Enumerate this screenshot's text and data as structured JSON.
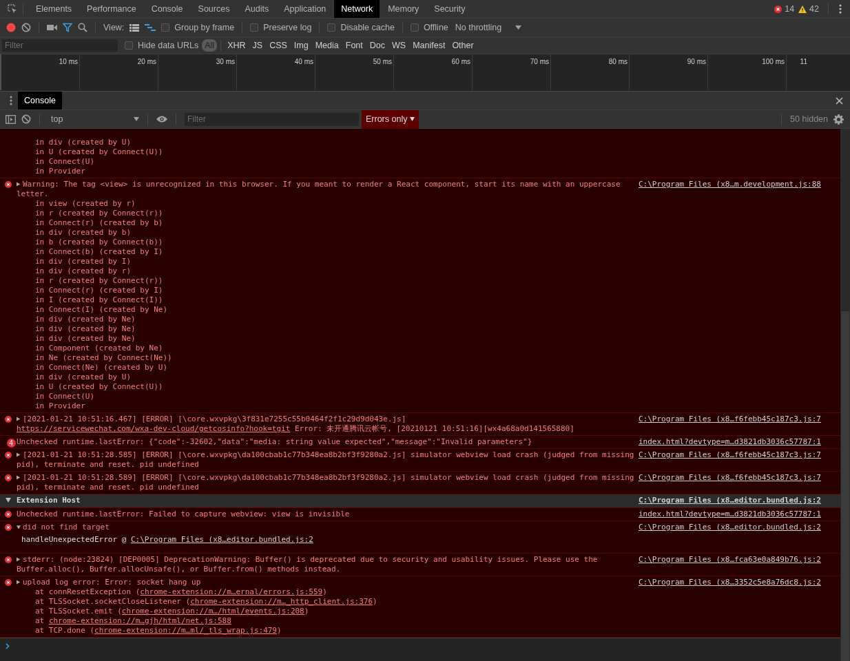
{
  "tabs": [
    {
      "label": "Elements",
      "selected": false
    },
    {
      "label": "Performance",
      "selected": false
    },
    {
      "label": "Console",
      "selected": false
    },
    {
      "label": "Sources",
      "selected": false
    },
    {
      "label": "Audits",
      "selected": false
    },
    {
      "label": "Application",
      "selected": false
    },
    {
      "label": "Network",
      "selected": true
    },
    {
      "label": "Memory",
      "selected": false
    },
    {
      "label": "Security",
      "selected": false
    }
  ],
  "counts": {
    "errors": "14",
    "warnings": "42"
  },
  "network_toolbar": {
    "recording": true,
    "filter_active": true,
    "view_label": "View:",
    "large_rows": false,
    "overview": true,
    "checkboxes": [
      {
        "label": "Group by frame",
        "checked": false
      },
      {
        "label": "Preserve log",
        "checked": false
      },
      {
        "label": "Disable cache",
        "checked": false
      },
      {
        "label": "Offline",
        "checked": false
      }
    ],
    "throttling": "No throttling"
  },
  "filter_bar": {
    "placeholder": "Filter",
    "hide_data_urls": {
      "label": "Hide data URLs",
      "checked": false
    },
    "types": [
      {
        "label": "All",
        "selected": true
      },
      {
        "label": "XHR",
        "selected": false
      },
      {
        "label": "JS",
        "selected": false
      },
      {
        "label": "CSS",
        "selected": false
      },
      {
        "label": "Img",
        "selected": false
      },
      {
        "label": "Media",
        "selected": false
      },
      {
        "label": "Font",
        "selected": false
      },
      {
        "label": "Doc",
        "selected": false
      },
      {
        "label": "WS",
        "selected": false
      },
      {
        "label": "Manifest",
        "selected": false
      },
      {
        "label": "Other",
        "selected": false
      }
    ]
  },
  "timeline": {
    "ticks": [
      "10 ms",
      "20 ms",
      "30 ms",
      "40 ms",
      "50 ms",
      "60 ms",
      "70 ms",
      "80 ms",
      "90 ms",
      "100 ms",
      "11"
    ]
  },
  "drawer": {
    "tabs": [
      {
        "label": "Console",
        "selected": true
      }
    ]
  },
  "console": {
    "context": "top",
    "filter_placeholder": "Filter",
    "level_filter": "Errors only",
    "hidden": "50 hidden",
    "messages": [
      {
        "kind": "continued",
        "stack": [
          {
            "kind": "frame",
            "text": "in div (created by U)"
          },
          {
            "kind": "frame",
            "text": "in U (created by Connect(U))"
          },
          {
            "kind": "frame",
            "text": "in Connect(U)"
          },
          {
            "kind": "frame",
            "text": "in Provider"
          }
        ]
      },
      {
        "kind": "error",
        "expanded": false,
        "parts": [
          {
            "kind": "text",
            "text": "Warning: The tag <view> is unrecognized in this browser. If you meant to render a React component, start its name with an uppercase letter."
          }
        ],
        "source": "C:\\Program Files (x8…m.development.js:88",
        "stack": [
          {
            "kind": "frame",
            "text": "in view (created by r)"
          },
          {
            "kind": "frame",
            "text": "in r (created by Connect(r))"
          },
          {
            "kind": "frame",
            "text": "in Connect(r) (created by b)"
          },
          {
            "kind": "frame",
            "text": "in div (created by b)"
          },
          {
            "kind": "frame",
            "text": "in b (created by Connect(b))"
          },
          {
            "kind": "frame",
            "text": "in Connect(b) (created by I)"
          },
          {
            "kind": "frame",
            "text": "in div (created by I)"
          },
          {
            "kind": "frame",
            "text": "in div (created by r)"
          },
          {
            "kind": "frame",
            "text": "in r (created by Connect(r))"
          },
          {
            "kind": "frame",
            "text": "in Connect(r) (created by I)"
          },
          {
            "kind": "frame",
            "text": "in I (created by Connect(I))"
          },
          {
            "kind": "frame",
            "text": "in Connect(I) (created by Ne)"
          },
          {
            "kind": "frame",
            "text": "in div (created by Ne)"
          },
          {
            "kind": "frame",
            "text": "in div (created by Ne)"
          },
          {
            "kind": "frame",
            "text": "in div (created by Ne)"
          },
          {
            "kind": "frame",
            "text": "in Component (created by Ne)"
          },
          {
            "kind": "frame",
            "text": "in Ne (created by Connect(Ne))"
          },
          {
            "kind": "frame",
            "text": "in Connect(Ne) (created by U)"
          },
          {
            "kind": "frame",
            "text": "in div (created by U)"
          },
          {
            "kind": "frame",
            "text": "in U (created by Connect(U))"
          },
          {
            "kind": "frame",
            "text": "in Connect(U)"
          },
          {
            "kind": "frame",
            "text": "in Provider"
          }
        ]
      },
      {
        "kind": "error",
        "expanded": false,
        "parts": [
          {
            "kind": "text",
            "text": "[2021-01-21 10:51:16.467] [ERROR] [\\core.wxvpkg\\3f831e7255c55b0464f2f1c29d9d043e.js] "
          },
          {
            "kind": "link",
            "text": "https://servicewechat.com/wxa-dev-cloud/getcosinfo?hook=tgit"
          },
          {
            "kind": "text",
            "text": " Error: 未开通腾讯云帐号, [20210121 10:51:16][wx4a68a0d141565880]"
          }
        ],
        "source": "C:\\Program Files (x8…f6febb45c187c3.js:7"
      },
      {
        "kind": "repeated",
        "count": "4",
        "parts": [
          {
            "kind": "text",
            "text": "Unchecked runtime.lastError: {\"code\":-32602,\"data\":\"media: string value expected\",\"message\":\"Invalid parameters\"}"
          }
        ],
        "source": "index.html?devtype=m…d3821db3036c57787:1"
      },
      {
        "kind": "error",
        "expanded": false,
        "parts": [
          {
            "kind": "text",
            "text": "[2021-01-21 10:51:28.585] [ERROR] [\\core.wxvpkg\\da100cbab1c77b348ea8b2bf3f9280a2.js] simulator webview load crash (judged from missing pid), terminate and reset. pid undefined"
          }
        ],
        "source": "C:\\Program Files (x8…f6febb45c187c3.js:7"
      },
      {
        "kind": "error",
        "expanded": false,
        "parts": [
          {
            "kind": "text",
            "text": "[2021-01-21 10:51:28.589] [ERROR] [\\core.wxvpkg\\da100cbab1c77b348ea8b2bf3f9280a2.js] simulator webview load crash (judged from missing pid), terminate and reset. pid undefined"
          }
        ],
        "source": "C:\\Program Files (x8…f6febb45c187c3.js:7"
      },
      {
        "kind": "group",
        "expanded": true,
        "parts": [
          {
            "kind": "text",
            "text": "Extension Host"
          }
        ],
        "source": "C:\\Program Files (x8…editor.bundled.js:2"
      },
      {
        "kind": "error",
        "parts": [
          {
            "kind": "text",
            "text": "Unchecked runtime.lastError: Failed to capture webview: view is invisible"
          }
        ],
        "source": "index.html?devtype=m…d3821db3036c57787:1"
      },
      {
        "kind": "error",
        "expanded": true,
        "parts": [
          {
            "kind": "text",
            "text": "did not find target"
          }
        ],
        "source": "C:\\Program Files (x8…editor.bundled.js:2",
        "stack": [
          {
            "kind": "call",
            "text": "handleUnexpectedError @ ",
            "link": "C:\\Program Files (x8…editor.bundled.js:2"
          }
        ]
      },
      {
        "kind": "error",
        "expanded": false,
        "parts": [
          {
            "kind": "text",
            "text": "stderr: (node:23824) [DEP0005] DeprecationWarning: Buffer() is deprecated due to security and usability issues. Please use the Buffer.alloc(), Buffer.allocUnsafe(), or Buffer.from() methods instead."
          }
        ],
        "source": "C:\\Program Files (x8…fca63e0a849b76.js:2"
      },
      {
        "kind": "error",
        "expanded": false,
        "parts": [
          {
            "kind": "text",
            "text": "upload log error: Error: socket hang up"
          }
        ],
        "source": "C:\\Program Files (x8…3352c5e8a76dc8.js:2",
        "stack": [
          {
            "kind": "frame",
            "text": "at connResetException (",
            "link": "chrome-extension://m…ernal/errors.js:559",
            "after": ")"
          },
          {
            "kind": "frame",
            "text": "at TLSSocket.socketCloseListener (",
            "link": "chrome-extension://m…_http_client.js:376",
            "after": ")"
          },
          {
            "kind": "frame",
            "text": "at TLSSocket.emit (",
            "link": "chrome-extension://m…/html/events.js:208",
            "after": ")"
          },
          {
            "kind": "frame",
            "text": "at ",
            "link": "chrome-extension://m…gjh/html/net.js:588"
          },
          {
            "kind": "frame",
            "text": "at TCP.done (",
            "link": "chrome-extension://m…ml/_tls_wrap.js:479",
            "after": ")"
          }
        ]
      }
    ]
  }
}
